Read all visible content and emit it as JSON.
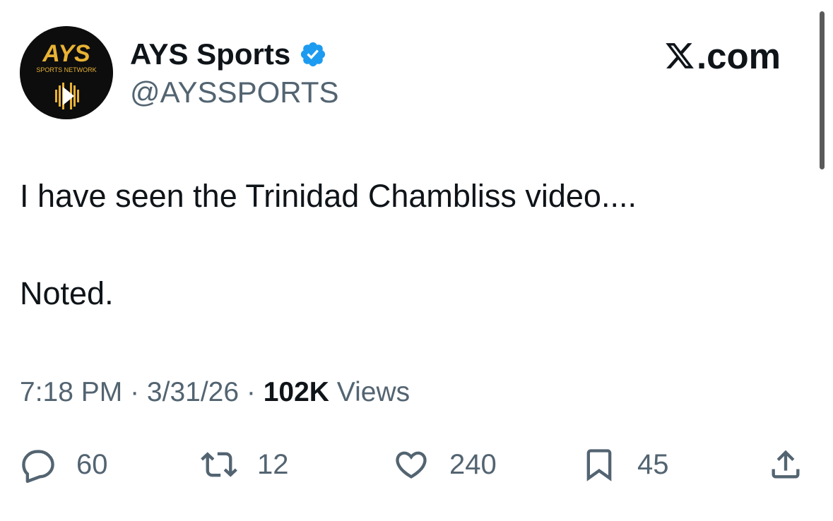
{
  "author": {
    "display_name": "AYS Sports",
    "handle": "@AYSSPORTS",
    "verified": true,
    "avatar_logo_text": "AYS",
    "avatar_logo_subtext": "SPORTS NETWORK"
  },
  "brand": {
    "label": ".com",
    "icon": "x-logo-icon"
  },
  "tweet": {
    "lines": [
      "I have seen the Trinidad Chambliss video....",
      "Noted."
    ]
  },
  "meta": {
    "time": "7:18 PM",
    "separator": " · ",
    "date": "3/31/26",
    "views_count": "102K",
    "views_label": " Views"
  },
  "actions": {
    "reply": {
      "icon": "reply-icon",
      "count": "60"
    },
    "retweet": {
      "icon": "retweet-icon",
      "count": "12"
    },
    "like": {
      "icon": "heart-icon",
      "count": "240"
    },
    "bookmark": {
      "icon": "bookmark-icon",
      "count": "45"
    },
    "share": {
      "icon": "share-icon"
    }
  },
  "colors": {
    "text": "#0f1419",
    "secondary": "#536471",
    "verified": "#1d9bf0",
    "logo_gold": "#e8b234"
  }
}
